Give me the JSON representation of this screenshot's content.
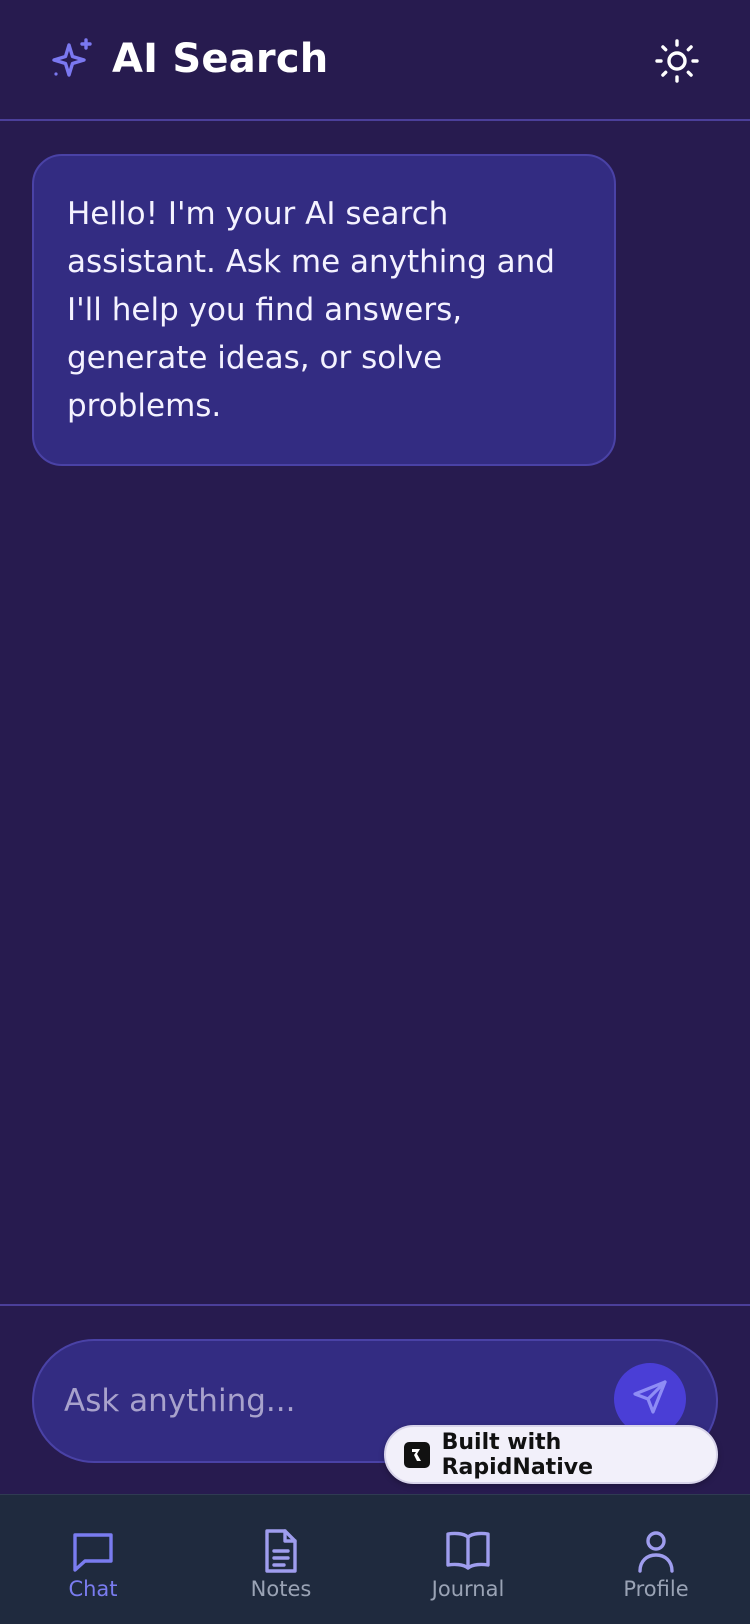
{
  "header": {
    "title": "AI Search",
    "brand_icon": "sparkles-icon",
    "theme_icon": "sun-icon"
  },
  "messages": [
    {
      "role": "assistant",
      "text": "Hello! I'm your AI search assistant. Ask me anything and I'll help you find answers, generate ideas, or solve problems."
    }
  ],
  "composer": {
    "placeholder": "Ask anything...",
    "value": "",
    "send_icon": "send-icon"
  },
  "badge": {
    "label": "Built with RapidNative"
  },
  "tabs": [
    {
      "label": "Chat",
      "icon": "chat-icon",
      "active": true
    },
    {
      "label": "Notes",
      "icon": "notes-icon",
      "active": false
    },
    {
      "label": "Journal",
      "icon": "book-icon",
      "active": false
    },
    {
      "label": "Profile",
      "icon": "user-icon",
      "active": false
    }
  ],
  "colors": {
    "background": "#271b4f",
    "bubble": "#332c82",
    "accent": "#6f6ae8",
    "send_button": "#4a3ed6",
    "tabbar": "#1f2a3e",
    "active_tab": "#7a7cf0",
    "inactive_tab": "#9aa3b5"
  }
}
